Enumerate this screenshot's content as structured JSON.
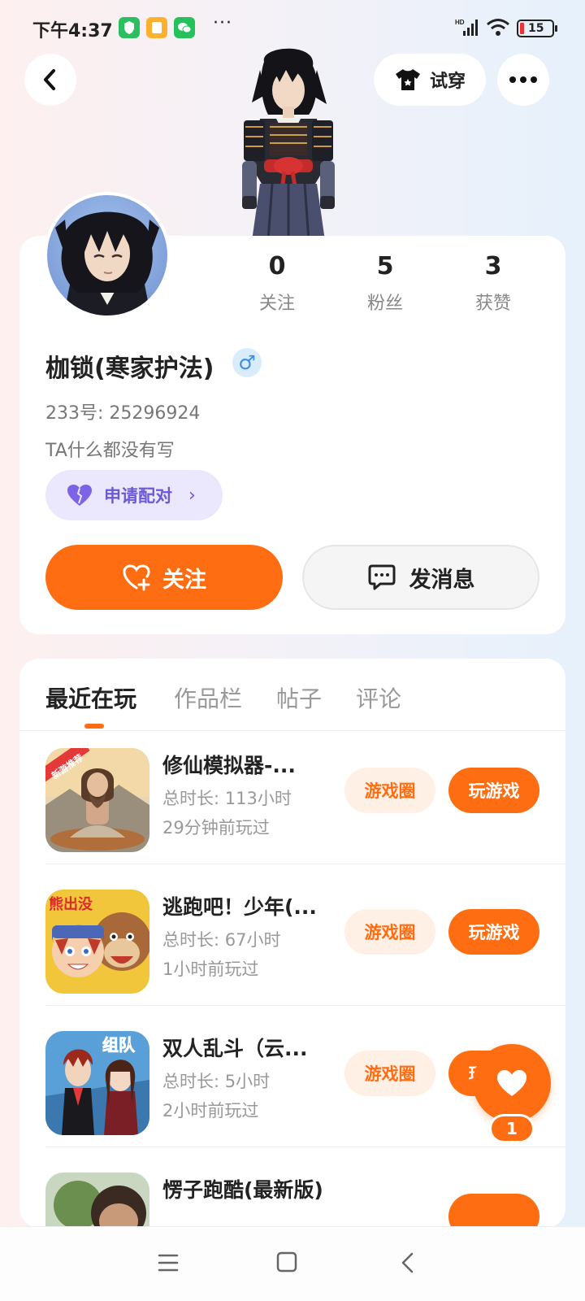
{
  "status_bar": {
    "time": "下午4:37",
    "more": "···",
    "battery": "15"
  },
  "header": {
    "tryon_label": "试穿"
  },
  "profile": {
    "name": "枷锁(寒家护法)",
    "gender_symbol": "♂",
    "id_text": "233号: 25296924",
    "bio": "TA什么都没有写",
    "pair_label": "申请配对",
    "stats": [
      {
        "value": "0",
        "label": "关注"
      },
      {
        "value": "5",
        "label": "粉丝"
      },
      {
        "value": "3",
        "label": "获赞"
      }
    ],
    "follow_label": "关注",
    "message_label": "发消息"
  },
  "tabs": [
    {
      "label": "最近在玩",
      "active": true
    },
    {
      "label": "作品栏",
      "active": false
    },
    {
      "label": "帖子",
      "active": false
    },
    {
      "label": "评论",
      "active": false
    }
  ],
  "games": [
    {
      "title": "修仙模拟器-...",
      "duration": "总时长: 113小时",
      "last_played": "29分钟前玩过",
      "circle_label": "游戏圈",
      "play_label": "玩游戏",
      "badge": "新游推荐"
    },
    {
      "title": "逃跑吧！少年(...",
      "duration": "总时长: 67小时",
      "last_played": "1小时前玩过",
      "circle_label": "游戏圈",
      "play_label": "玩游戏",
      "badge": "熊出没"
    },
    {
      "title": "双人乱斗（云...",
      "duration": "总时长: 5小时",
      "last_played": "2小时前玩过",
      "circle_label": "游戏圈",
      "play_label": "玩游戏",
      "badge": "组队"
    },
    {
      "title": "愣子跑酷(最新版)",
      "duration": "",
      "last_played": "",
      "circle_label": "",
      "play_label": "",
      "badge": ""
    }
  ],
  "fab": {
    "count": "1"
  },
  "colors": {
    "accent": "#ff6d12",
    "accent_light": "#fff0e5",
    "pair_bg": "#ebe7fd",
    "pair_text": "#6a5ad6",
    "gender": "#3b8ee6"
  },
  "icons": [
    "back-arrow-icon",
    "tshirt-icon",
    "more-dots-icon",
    "heart-icon",
    "add-heart-icon",
    "chat-icon",
    "menu-icon",
    "home-square-icon",
    "nav-back-icon"
  ]
}
